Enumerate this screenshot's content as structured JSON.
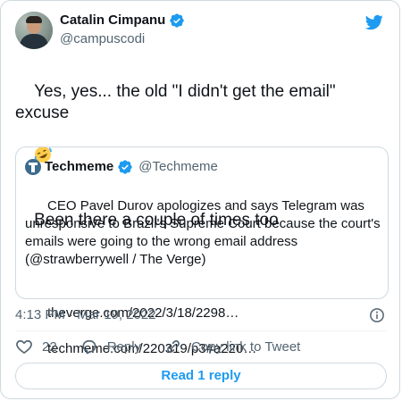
{
  "author": {
    "name": "Catalin Cimpanu",
    "handle": "@campuscodi"
  },
  "tweet": {
    "line1": "Yes, yes... the old \"I didn't get the email\" excuse",
    "line3": "Been there a couple of times too"
  },
  "quoted": {
    "name": "Techmeme",
    "handle": "@Techmeme",
    "text": "CEO Pavel Durov apologizes and says Telegram was unresponsive to Brazil's Supreme Court because the court's emails were going to the wrong email address (@strawberrywell / The Verge)",
    "link1": "theverge.com/2022/3/18/2298…",
    "link2": "techmeme.com/220319/p3#a220…"
  },
  "timestamp": "4:13 PM · Mar 19, 2022",
  "actions": {
    "likes": "22",
    "reply": "Reply",
    "copy_link": "Copy link to Tweet"
  },
  "read_reply": "Read 1 reply",
  "colors": {
    "twitter_blue": "#1d9bf0",
    "secondary_text": "#536471",
    "like_red": "#f91880"
  },
  "icons": [
    "twitter-bird-icon",
    "verified-badge-icon",
    "rofl-emoji-icon",
    "info-icon",
    "heart-icon",
    "reply-icon",
    "link-icon",
    "techmeme-logo-icon"
  ]
}
